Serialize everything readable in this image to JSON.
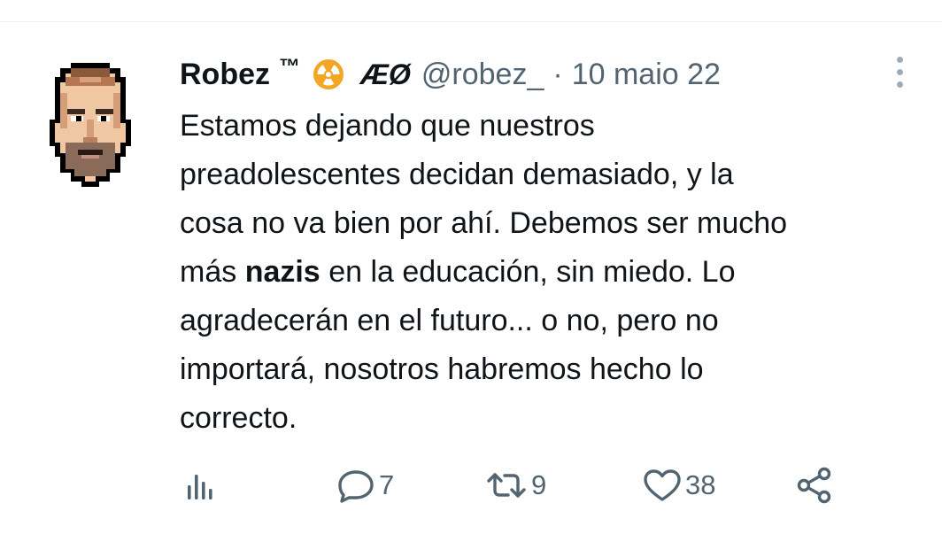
{
  "tweet": {
    "display_name": "Robez",
    "name_suffix": "™",
    "name_extra": "ÆØ",
    "handle": "@robez_",
    "separator": "·",
    "date": "10 maio 22",
    "text_lines": [
      "Estamos dejando que nuestros",
      "preadolescentes decidan demasiado, y la",
      "cosa no va bien por ahí. Debemos ser mucho"
    ],
    "line4_before": "más",
    "line4_bold": "nazis",
    "line4_after": "en la educación, sin miedo. Lo",
    "text_lines_tail": [
      "agradecerán en el futuro... o no, pero no",
      "importará, nosotros habremos hecho lo",
      "correcto."
    ]
  },
  "actions": {
    "replies": "7",
    "retweets": "9",
    "likes": "38"
  },
  "icons": {
    "avatar": "pixel-art-face-avatar",
    "badge": "radiation-icon",
    "more": "more-vertical-icon",
    "analytics": "analytics-icon",
    "reply": "reply-icon",
    "retweet": "retweet-icon",
    "like": "heart-icon",
    "share": "share-icon"
  },
  "colors": {
    "text": "#0f1419",
    "secondary": "#536471",
    "radiation": "#f4a522"
  }
}
